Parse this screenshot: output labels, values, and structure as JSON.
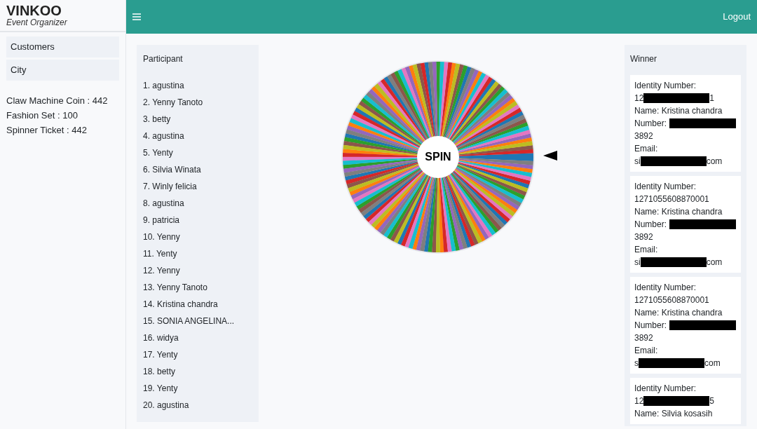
{
  "brand": {
    "name": "VINKOO",
    "subtitle": "Event Organizer"
  },
  "sidebar": {
    "items": [
      {
        "label": "Customers"
      },
      {
        "label": "City"
      }
    ],
    "stats": [
      "Claw Machine Coin : 442",
      "Fashion Set : 100",
      "Spinner Ticket : 442"
    ]
  },
  "topbar": {
    "logout": "Logout"
  },
  "participants": {
    "title": "Participant",
    "items": [
      "1. agustina",
      "2. Yenny Tanoto",
      "3. betty",
      "4. agustina",
      "5. Yenty",
      "6. Silvia Winata",
      "7. Winly felicia",
      "8. agustina",
      "9. patricia",
      "10. Yenny",
      "11. Yenty",
      "12. Yenny",
      "13. Yenny Tanoto",
      "14. Kristina chandra",
      "15. SONIA ANGELINA...",
      "16. widya",
      "17. Yenty",
      "18. betty",
      "19. Yenty",
      "20. agustina"
    ]
  },
  "wheel": {
    "button": "SPIN"
  },
  "winners": {
    "title": "Winner",
    "cards": [
      {
        "lines": [
          {
            "kind": "text",
            "text": "Identity Number:"
          },
          {
            "kind": "redacted",
            "before": "12",
            "after": "1"
          },
          {
            "kind": "text",
            "text": "Name: Kristina chandra"
          },
          {
            "kind": "redacted",
            "before": "Number:"
          },
          {
            "kind": "text",
            "text": "3892"
          },
          {
            "kind": "text",
            "text": "Email:"
          },
          {
            "kind": "redacted",
            "before": "si",
            "after": "com"
          }
        ]
      },
      {
        "lines": [
          {
            "kind": "text",
            "text": "Identity Number:"
          },
          {
            "kind": "text",
            "text": "1271055608870001"
          },
          {
            "kind": "text",
            "text": "Name: Kristina chandra"
          },
          {
            "kind": "redacted",
            "before": "Number:"
          },
          {
            "kind": "text",
            "text": "3892"
          },
          {
            "kind": "text",
            "text": "Email:"
          },
          {
            "kind": "redacted",
            "before": "si",
            "after": "com"
          }
        ]
      },
      {
        "lines": [
          {
            "kind": "text",
            "text": "Identity Number:"
          },
          {
            "kind": "text",
            "text": "1271055608870001"
          },
          {
            "kind": "text",
            "text": "Name: Kristina chandra"
          },
          {
            "kind": "redacted",
            "before": "Number:"
          },
          {
            "kind": "text",
            "text": "3892"
          },
          {
            "kind": "text",
            "text": "Email:"
          },
          {
            "kind": "redacted",
            "before": "s",
            "after": "com"
          }
        ]
      },
      {
        "lines": [
          {
            "kind": "text",
            "text": "Identity Number:"
          },
          {
            "kind": "redacted",
            "before": "12",
            "after": "5"
          },
          {
            "kind": "text",
            "text": "Name: Silvia kosasih"
          }
        ]
      }
    ]
  }
}
